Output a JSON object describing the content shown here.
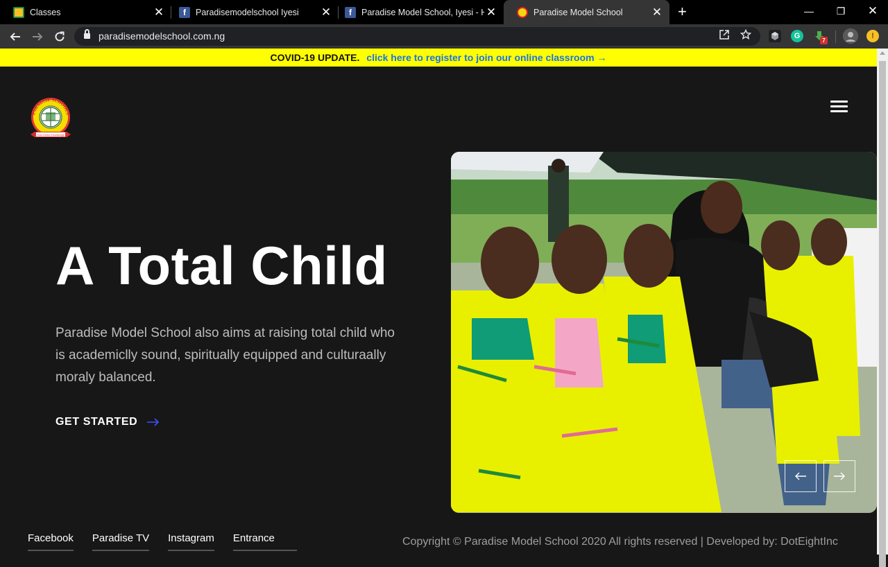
{
  "browser": {
    "tabs": [
      {
        "title": "Classes",
        "favicon": "google-classroom-icon",
        "active": false
      },
      {
        "title": "Paradisemodelschool Iyesi",
        "favicon": "facebook-icon",
        "active": false
      },
      {
        "title": "Paradise Model School, Iyesi - Ho",
        "favicon": "facebook-icon",
        "active": false
      },
      {
        "title": "Paradise Model School",
        "favicon": "school-logo-icon",
        "active": true
      }
    ],
    "url": "paradisemodelschool.com.ng",
    "extension_badge": "7"
  },
  "banner": {
    "label": "COVID-19 UPDATE.",
    "link": "click here to register to join our online classroom →",
    "background": "#ffff00",
    "link_color": "#1a73e8"
  },
  "hero": {
    "headline": "A Total Child",
    "lead": "Paradise Model School also aims at raising total child who is academiclly sound, spiritually equipped and culturaally moraly balanced.",
    "cta": "GET STARTED",
    "cta_arrow_color": "#3f51ff",
    "image_alt": "Students in yellow school uniforms sitting with a teacher"
  },
  "footer": {
    "links": [
      "Facebook",
      "Paradise TV",
      "Instagram",
      "Entrance"
    ],
    "copyright": "Copyright © Paradise Model School 2020 All rights reserved | Developed by:",
    "developer": "DotEightInc"
  }
}
